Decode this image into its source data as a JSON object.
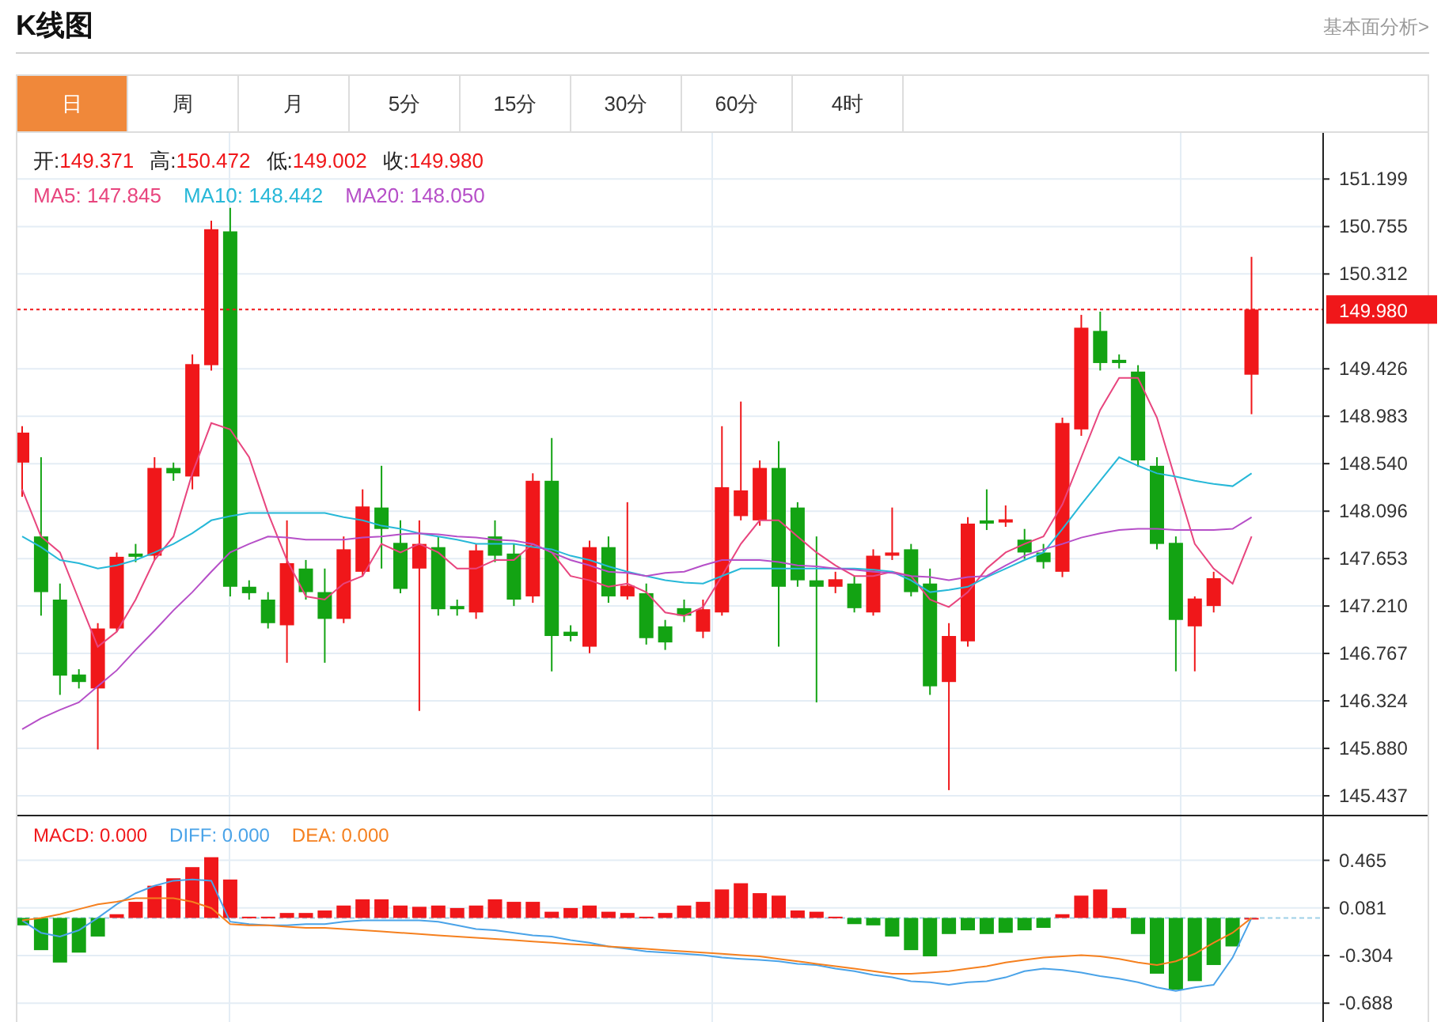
{
  "header": {
    "title": "K线图",
    "link": "基本面分析>"
  },
  "tabs": [
    {
      "label": "日",
      "selected": true
    },
    {
      "label": "周",
      "selected": false
    },
    {
      "label": "月",
      "selected": false
    },
    {
      "label": "5分",
      "selected": false
    },
    {
      "label": "15分",
      "selected": false
    },
    {
      "label": "30分",
      "selected": false
    },
    {
      "label": "60分",
      "selected": false
    },
    {
      "label": "4时",
      "selected": false
    }
  ],
  "price_chart": {
    "ohlc": [
      {
        "label": "开:",
        "value": "149.371"
      },
      {
        "label": "高:",
        "value": "150.472"
      },
      {
        "label": "低:",
        "value": "149.002"
      },
      {
        "label": "收:",
        "value": "149.980"
      }
    ],
    "moving_averages": [
      {
        "value": ": 147.845"
      },
      {
        "value": ": 148.442"
      },
      {
        "value": ": 148.050"
      }
    ],
    "last_price": "149.980",
    "chart_data": {
      "type": "candlestick",
      "grid": true,
      "ylim": [
        145.26,
        151.63
      ],
      "yticks": [
        {
          "value": 151.199,
          "label": "151.199"
        },
        {
          "value": 150.755,
          "label": "150.755"
        },
        {
          "value": 150.312,
          "label": "150.312"
        },
        {
          "value": 149.426,
          "label": "149.426"
        },
        {
          "value": 148.983,
          "label": "148.983"
        },
        {
          "value": 148.54,
          "label": "148.540"
        },
        {
          "value": 148.096,
          "label": "148.096"
        },
        {
          "value": 147.653,
          "label": "147.653"
        },
        {
          "value": 147.21,
          "label": "147.210"
        },
        {
          "value": 146.767,
          "label": "146.767"
        },
        {
          "value": 146.324,
          "label": "146.324"
        },
        {
          "value": 145.88,
          "label": "145.880"
        },
        {
          "value": 145.437,
          "label": "145.437"
        }
      ],
      "ref_lines": [
        {
          "axis": "y",
          "value": 149.98
        }
      ],
      "ohlc": [
        [
          148.55,
          148.89,
          148.23,
          148.83
        ],
        [
          147.86,
          148.6,
          147.12,
          147.34
        ],
        [
          147.27,
          147.42,
          146.38,
          146.56
        ],
        [
          146.57,
          146.62,
          146.44,
          146.5
        ],
        [
          146.44,
          147.05,
          145.87,
          147.0
        ],
        [
          147.0,
          147.71,
          146.97,
          147.67
        ],
        [
          147.7,
          147.79,
          147.62,
          147.67
        ],
        [
          147.68,
          148.6,
          147.64,
          148.5
        ],
        [
          148.5,
          148.55,
          148.38,
          148.45
        ],
        [
          148.42,
          149.56,
          148.3,
          149.47
        ],
        [
          149.46,
          150.81,
          149.41,
          150.73
        ],
        [
          150.71,
          150.93,
          147.3,
          147.39
        ],
        [
          147.39,
          147.45,
          147.27,
          147.33
        ],
        [
          147.27,
          147.34,
          147.0,
          147.05
        ],
        [
          147.03,
          148.01,
          146.68,
          147.61
        ],
        [
          147.56,
          147.64,
          147.27,
          147.34
        ],
        [
          147.34,
          147.56,
          146.68,
          147.09
        ],
        [
          147.09,
          147.86,
          147.05,
          147.74
        ],
        [
          147.53,
          148.3,
          147.49,
          148.14
        ],
        [
          148.13,
          148.52,
          147.56,
          147.93
        ],
        [
          147.8,
          148.01,
          147.33,
          147.37
        ],
        [
          147.56,
          148.01,
          146.23,
          147.79
        ],
        [
          147.76,
          147.86,
          147.12,
          147.18
        ],
        [
          147.21,
          147.27,
          147.12,
          147.18
        ],
        [
          147.15,
          147.79,
          147.09,
          147.73
        ],
        [
          147.86,
          148.01,
          147.62,
          147.68
        ],
        [
          147.7,
          147.79,
          147.21,
          147.27
        ],
        [
          147.3,
          148.45,
          147.24,
          148.38
        ],
        [
          148.38,
          148.78,
          146.6,
          146.93
        ],
        [
          146.97,
          147.03,
          146.88,
          146.93
        ],
        [
          146.83,
          147.82,
          146.77,
          147.76
        ],
        [
          147.76,
          147.86,
          147.24,
          147.3
        ],
        [
          147.3,
          148.18,
          147.27,
          147.4
        ],
        [
          147.33,
          147.42,
          146.85,
          146.91
        ],
        [
          147.02,
          147.08,
          146.8,
          146.87
        ],
        [
          147.19,
          147.27,
          147.06,
          147.12
        ],
        [
          146.97,
          147.27,
          146.91,
          147.18
        ],
        [
          147.15,
          148.89,
          147.12,
          148.32
        ],
        [
          148.05,
          149.12,
          148.01,
          148.29
        ],
        [
          148.01,
          148.57,
          147.96,
          148.5
        ],
        [
          148.5,
          148.75,
          146.83,
          147.39
        ],
        [
          148.13,
          148.18,
          147.39,
          147.45
        ],
        [
          147.45,
          147.86,
          146.31,
          147.39
        ],
        [
          147.39,
          147.53,
          147.33,
          147.46
        ],
        [
          147.42,
          147.49,
          147.15,
          147.19
        ],
        [
          147.15,
          147.74,
          147.12,
          147.68
        ],
        [
          147.68,
          148.13,
          147.64,
          147.71
        ],
        [
          147.74,
          147.79,
          147.3,
          147.34
        ],
        [
          147.42,
          147.56,
          146.38,
          146.46
        ],
        [
          146.5,
          147.05,
          145.49,
          146.93
        ],
        [
          146.88,
          148.04,
          146.83,
          147.98
        ],
        [
          148.01,
          148.3,
          147.92,
          147.98
        ],
        [
          147.99,
          148.15,
          147.95,
          148.02
        ],
        [
          147.83,
          147.93,
          147.65,
          147.71
        ],
        [
          147.71,
          147.79,
          147.56,
          147.62
        ],
        [
          147.53,
          148.97,
          147.48,
          148.92
        ],
        [
          148.86,
          149.93,
          148.8,
          149.81
        ],
        [
          149.78,
          149.96,
          149.41,
          149.48
        ],
        [
          149.51,
          149.56,
          149.43,
          149.48
        ],
        [
          149.4,
          149.46,
          148.51,
          148.57
        ],
        [
          148.52,
          148.6,
          147.74,
          147.79
        ],
        [
          147.8,
          147.86,
          146.6,
          147.08
        ],
        [
          147.02,
          147.3,
          146.6,
          147.28
        ],
        [
          147.21,
          147.53,
          147.15,
          147.47
        ],
        null,
        [
          149.371,
          150.472,
          149.002,
          149.98
        ]
      ],
      "series": [
        {
          "name": "MA5",
          "type": "line",
          "color": "#e8457e",
          "values": [
            148.3,
            147.86,
            147.71,
            147.27,
            146.83,
            146.97,
            147.27,
            147.64,
            147.86,
            148.45,
            148.92,
            148.86,
            148.6,
            148.08,
            147.64,
            147.3,
            147.27,
            147.42,
            147.49,
            147.79,
            147.71,
            147.79,
            147.71,
            147.56,
            147.56,
            147.64,
            147.64,
            147.79,
            147.71,
            147.49,
            147.45,
            147.39,
            147.42,
            147.34,
            147.15,
            147.12,
            147.2,
            147.49,
            147.79,
            148.01,
            148.01,
            147.86,
            147.71,
            147.59,
            147.49,
            147.49,
            147.53,
            147.49,
            147.27,
            147.2,
            147.34,
            147.56,
            147.71,
            147.79,
            147.86,
            148.16,
            148.6,
            149.04,
            149.34,
            149.34,
            148.97,
            148.38,
            147.79,
            147.56,
            147.42,
            147.86
          ]
        },
        {
          "name": "MA10",
          "type": "line",
          "color": "#27b8d8",
          "values": [
            147.86,
            147.76,
            147.64,
            147.61,
            147.56,
            147.59,
            147.64,
            147.71,
            147.79,
            147.89,
            148.01,
            148.05,
            148.08,
            148.08,
            148.08,
            148.08,
            148.08,
            148.04,
            148.01,
            147.96,
            147.93,
            147.89,
            147.86,
            147.83,
            147.79,
            147.79,
            147.79,
            147.76,
            147.74,
            147.68,
            147.64,
            147.58,
            147.53,
            147.49,
            147.45,
            147.43,
            147.42,
            147.49,
            147.56,
            147.56,
            147.56,
            147.56,
            147.56,
            147.56,
            147.56,
            147.55,
            147.53,
            147.45,
            147.34,
            147.36,
            147.39,
            147.48,
            147.56,
            147.64,
            147.71,
            147.93,
            148.16,
            148.38,
            148.6,
            148.52,
            148.45,
            148.42,
            148.38,
            148.35,
            148.33,
            148.45
          ]
        },
        {
          "name": "MA20",
          "type": "line",
          "color": "#b64fc8",
          "values": [
            146.06,
            146.16,
            146.24,
            146.31,
            146.46,
            146.61,
            146.8,
            146.98,
            147.17,
            147.34,
            147.53,
            147.71,
            147.79,
            147.86,
            147.85,
            147.83,
            147.83,
            147.83,
            147.85,
            147.86,
            147.88,
            147.89,
            147.88,
            147.86,
            147.85,
            147.83,
            147.82,
            147.79,
            147.71,
            147.64,
            147.59,
            147.53,
            147.52,
            147.49,
            147.52,
            147.53,
            147.59,
            147.64,
            147.64,
            147.64,
            147.62,
            147.59,
            147.58,
            147.56,
            147.55,
            147.53,
            147.52,
            147.49,
            147.48,
            147.45,
            147.48,
            147.49,
            147.59,
            147.68,
            147.74,
            147.79,
            147.85,
            147.89,
            147.92,
            147.93,
            147.93,
            147.92,
            147.92,
            147.92,
            147.93,
            148.04
          ]
        }
      ]
    }
  },
  "macd_chart": {
    "legend": [
      {
        "value": ": 0.000"
      },
      {
        "value": ": 0.000"
      },
      {
        "value": ": 0.000"
      }
    ],
    "chart_data": {
      "type": "bar",
      "grid": true,
      "ylim": [
        -0.84,
        0.82
      ],
      "ref_lines": [
        {
          "axis": "y",
          "value": 0
        }
      ],
      "yticks": [
        {
          "value": 0.465,
          "label": "0.465"
        },
        {
          "value": 0.081,
          "label": "0.081"
        },
        {
          "value": -0.304,
          "label": "-0.304"
        },
        {
          "value": -0.688,
          "label": "-0.688"
        }
      ],
      "series": [
        {
          "name": "MACD",
          "type": "bar",
          "color": "#f0171a",
          "colors": [
            "#13a313",
            "#13a313",
            "#13a313",
            "#13a313",
            "#13a313",
            "#f0171a",
            "#f0171a",
            "#f0171a",
            "#f0171a",
            "#f0171a",
            "#f0171a",
            "#f0171a",
            "#f0171a",
            "#f0171a",
            "#f0171a",
            "#f0171a",
            "#f0171a",
            "#f0171a",
            "#f0171a",
            "#f0171a",
            "#f0171a",
            "#f0171a",
            "#f0171a",
            "#f0171a",
            "#f0171a",
            "#f0171a",
            "#f0171a",
            "#f0171a",
            "#f0171a",
            "#f0171a",
            "#f0171a",
            "#f0171a",
            "#f0171a",
            "#f0171a",
            "#f0171a",
            "#f0171a",
            "#f0171a",
            "#f0171a",
            "#f0171a",
            "#f0171a",
            "#f0171a",
            "#f0171a",
            "#f0171a",
            "#f0171a",
            "#13a313",
            "#13a313",
            "#13a313",
            "#13a313",
            "#13a313",
            "#13a313",
            "#13a313",
            "#13a313",
            "#13a313",
            "#13a313",
            "#13a313",
            "#f0171a",
            "#f0171a",
            "#f0171a",
            "#f0171a",
            "#13a313",
            "#13a313",
            "#13a313",
            "#13a313",
            "#13a313",
            "#13a313",
            "#f0171a"
          ],
          "values": [
            -0.06,
            -0.26,
            -0.36,
            -0.28,
            -0.15,
            0.03,
            0.13,
            0.26,
            0.32,
            0.41,
            0.49,
            0.31,
            0.01,
            0.01,
            0.04,
            0.04,
            0.06,
            0.1,
            0.15,
            0.15,
            0.1,
            0.09,
            0.1,
            0.08,
            0.1,
            0.15,
            0.13,
            0.13,
            0.05,
            0.08,
            0.1,
            0.05,
            0.04,
            0.01,
            0.04,
            0.1,
            0.13,
            0.23,
            0.28,
            0.2,
            0.18,
            0.06,
            0.05,
            0.01,
            -0.05,
            -0.06,
            -0.15,
            -0.26,
            -0.31,
            -0.13,
            -0.1,
            -0.13,
            -0.12,
            -0.1,
            -0.08,
            0.03,
            0.18,
            0.23,
            0.08,
            -0.13,
            -0.45,
            -0.58,
            -0.51,
            -0.38,
            -0.23,
            0.0
          ]
        },
        {
          "name": "DIFF",
          "type": "line",
          "color": "#4aa3e8",
          "values": [
            -0.02,
            -0.12,
            -0.15,
            -0.1,
            0.0,
            0.11,
            0.2,
            0.26,
            0.3,
            0.31,
            0.3,
            -0.03,
            -0.05,
            -0.06,
            -0.06,
            -0.05,
            -0.05,
            -0.03,
            -0.02,
            -0.02,
            -0.02,
            -0.02,
            -0.03,
            -0.06,
            -0.09,
            -0.1,
            -0.12,
            -0.14,
            -0.15,
            -0.18,
            -0.2,
            -0.23,
            -0.25,
            -0.27,
            -0.28,
            -0.29,
            -0.3,
            -0.32,
            -0.33,
            -0.34,
            -0.35,
            -0.37,
            -0.38,
            -0.41,
            -0.43,
            -0.46,
            -0.48,
            -0.51,
            -0.52,
            -0.54,
            -0.52,
            -0.51,
            -0.48,
            -0.43,
            -0.41,
            -0.42,
            -0.44,
            -0.47,
            -0.49,
            -0.52,
            -0.56,
            -0.59,
            -0.56,
            -0.54,
            -0.32,
            0.0
          ]
        },
        {
          "name": "DEA",
          "type": "line",
          "color": "#f5801f",
          "values": [
            -0.02,
            0.0,
            0.03,
            0.07,
            0.11,
            0.13,
            0.16,
            0.16,
            0.16,
            0.13,
            0.08,
            -0.05,
            -0.06,
            -0.06,
            -0.07,
            -0.08,
            -0.08,
            -0.09,
            -0.1,
            -0.11,
            -0.12,
            -0.13,
            -0.14,
            -0.15,
            -0.16,
            -0.17,
            -0.18,
            -0.19,
            -0.2,
            -0.21,
            -0.22,
            -0.23,
            -0.24,
            -0.25,
            -0.26,
            -0.27,
            -0.28,
            -0.29,
            -0.3,
            -0.31,
            -0.33,
            -0.35,
            -0.37,
            -0.39,
            -0.41,
            -0.43,
            -0.45,
            -0.45,
            -0.44,
            -0.43,
            -0.41,
            -0.39,
            -0.36,
            -0.34,
            -0.32,
            -0.31,
            -0.3,
            -0.31,
            -0.33,
            -0.36,
            -0.38,
            -0.35,
            -0.29,
            -0.2,
            -0.12,
            0.0
          ]
        }
      ]
    }
  }
}
